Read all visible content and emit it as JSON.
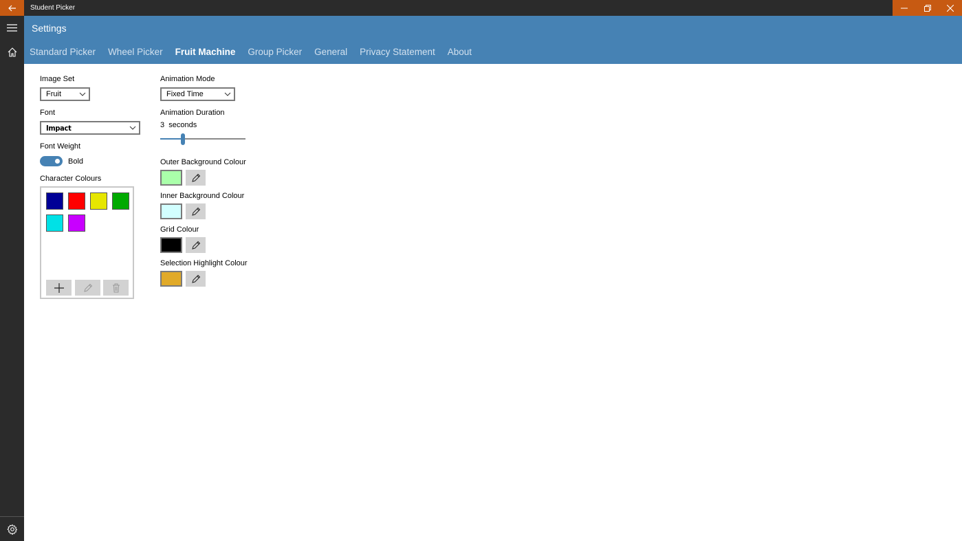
{
  "window": {
    "title": "Student Picker",
    "icons": [
      "arrow-left-icon",
      "minimize-icon",
      "restore-icon",
      "close-icon"
    ]
  },
  "nav": {
    "icons": [
      "hamburger-icon",
      "home-icon",
      "gear-icon"
    ]
  },
  "header": {
    "title": "Settings",
    "tabs": [
      {
        "label": "Standard Picker",
        "active": false
      },
      {
        "label": "Wheel Picker",
        "active": false
      },
      {
        "label": "Fruit Machine",
        "active": true
      },
      {
        "label": "Group Picker",
        "active": false
      },
      {
        "label": "General",
        "active": false
      },
      {
        "label": "Privacy Statement",
        "active": false
      },
      {
        "label": "About",
        "active": false
      }
    ]
  },
  "settings": {
    "image_set": {
      "label": "Image Set",
      "value": "Fruit"
    },
    "font": {
      "label": "Font",
      "value": "Impact"
    },
    "font_weight": {
      "label": "Font Weight",
      "toggle_label": "Bold",
      "on": true
    },
    "character_colours": {
      "label": "Character Colours",
      "colours": [
        "#000096",
        "#ff0000",
        "#e6e600",
        "#00aa00",
        "#00e1e6",
        "#c800ff"
      ],
      "buttons": [
        "add-icon",
        "edit-icon",
        "delete-icon"
      ]
    },
    "animation_mode": {
      "label": "Animation Mode",
      "value": "Fixed Time"
    },
    "animation_duration": {
      "label": "Animation Duration",
      "value": "3",
      "unit": "seconds",
      "slider_fraction": 0.27
    },
    "outer_background": {
      "label": "Outer Background Colour",
      "colour": "#aaffaa"
    },
    "inner_background": {
      "label": "Inner Background Colour",
      "colour": "#d2ffff"
    },
    "grid_colour": {
      "label": "Grid Colour",
      "colour": "#000000"
    },
    "selection_highlight": {
      "label": "Selection Highlight Colour",
      "colour": "#e1aa28"
    }
  },
  "colors": {
    "accent": "#4682b4",
    "title_accent": "#c75a12",
    "rail": "#2b2b2b"
  }
}
